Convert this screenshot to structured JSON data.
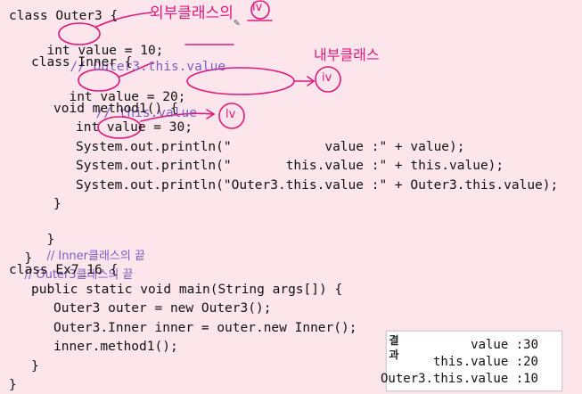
{
  "code": {
    "l1": "class Outer3 {",
    "l2_code": "int value = 10;",
    "l2_comment": "// Outer3.this.value",
    "l3": "class Inner {",
    "l4_code": "int value = 20;",
    "l4_comment": "// this.value",
    "l5": "void method1() {",
    "l6": "int value = 30;",
    "l7": "System.out.println(\"            value :\" + value);",
    "l8": "System.out.println(\"       this.value :\" + this.value);",
    "l9": "System.out.println(\"Outer3.this.value :\" + Outer3.this.value);",
    "l10": "}",
    "l11_brace": "}",
    "l11_comment": "// Inner클래스의 끝",
    "l12_brace": "}",
    "l12_comment": "// Outer3클래스의 끝",
    "l13": "class Ex7_16 {",
    "l14": "public static void main(String args[]) {",
    "l15": "Outer3 outer = new Outer3();",
    "l16": "Outer3.Inner inner = outer.new Inner();",
    "l17": "inner.method1();",
    "l18": "}",
    "l19": "}"
  },
  "annotations": {
    "outer_class_note": "외부클래스의",
    "outer_badge": "iv",
    "inner_class_note": "내부클래스",
    "inner_badge": "iv",
    "local_badge": "lv"
  },
  "output": {
    "label": "결과",
    "lines": [
      "value :30",
      "this.value :20",
      "Outer3.this.value :10"
    ]
  },
  "colors": {
    "background": "#fde5ec",
    "ink": "#e0197a",
    "comment": "#7b5cc2"
  }
}
